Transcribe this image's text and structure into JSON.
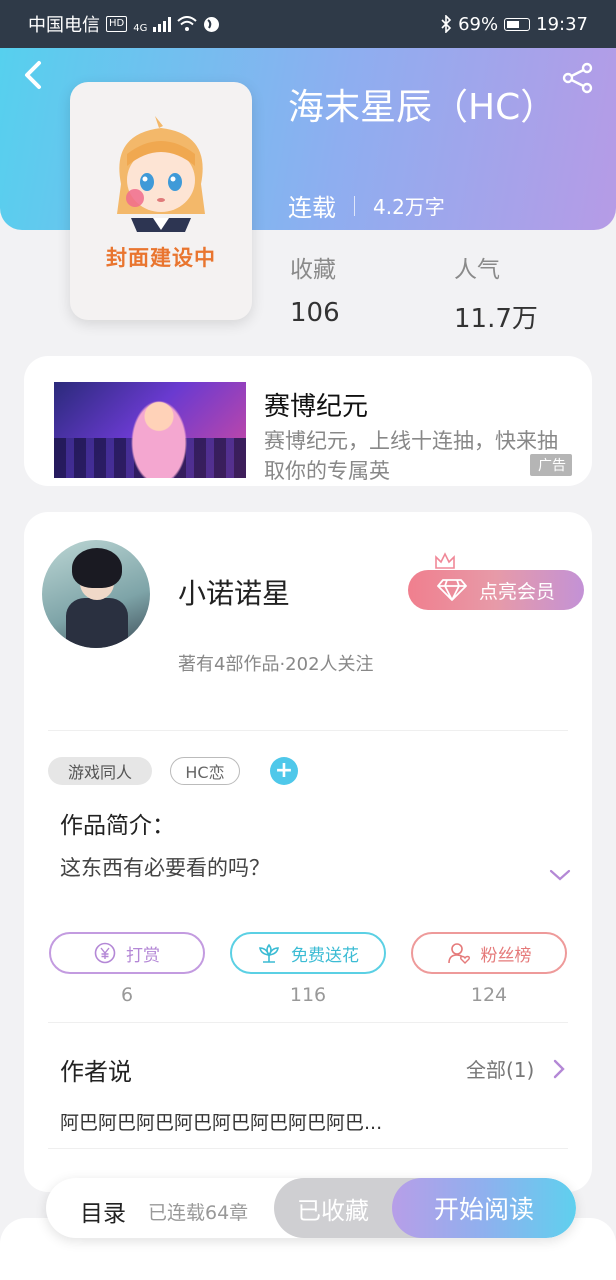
{
  "status_bar": {
    "carrier": "中国电信",
    "hd": "HD",
    "network": "4G",
    "battery": "69%",
    "time": "19:37"
  },
  "header": {
    "back_icon": "back-arrow-icon",
    "share_icon": "share-icon",
    "cover_text": "封面建设中",
    "title": "海末星辰（HC）",
    "status": "连载",
    "word_count": "4.2万字",
    "gradient": [
      "#56d0ee",
      "#b69be6"
    ]
  },
  "stats": [
    {
      "label": "收藏",
      "value": "106"
    },
    {
      "label": "人气",
      "value": "11.7万"
    }
  ],
  "ad": {
    "title": "赛博纪元",
    "description": "赛博纪元，上线十连抽，快来抽取你的专属英",
    "badge": "广告"
  },
  "author": {
    "name": "小诺诺星",
    "meta": "著有4部作品·202人关注",
    "vip_label": "点亮会员"
  },
  "tags": [
    "游戏同人",
    "HC恋"
  ],
  "intro": {
    "heading": "作品简介：",
    "text": "这东西有必要看的吗？"
  },
  "actions": [
    {
      "label": "打赏",
      "count": "6",
      "icon": "yen-coin-icon",
      "color": "#b488d6"
    },
    {
      "label": "免费送花",
      "count": "116",
      "icon": "flower-icon",
      "color": "#3cbcd4"
    },
    {
      "label": "粉丝榜",
      "count": "124",
      "icon": "fan-user-icon",
      "color": "#e57a7a"
    }
  ],
  "author_says": {
    "heading": "作者说",
    "all_label": "全部(1)",
    "text": "阿巴阿巴阿巴阿巴阿巴阿巴阿巴阿巴..."
  },
  "bottom_bar": {
    "toc": "目录",
    "chapters": "已连载64章",
    "collected": "已收藏",
    "read": "开始阅读"
  }
}
